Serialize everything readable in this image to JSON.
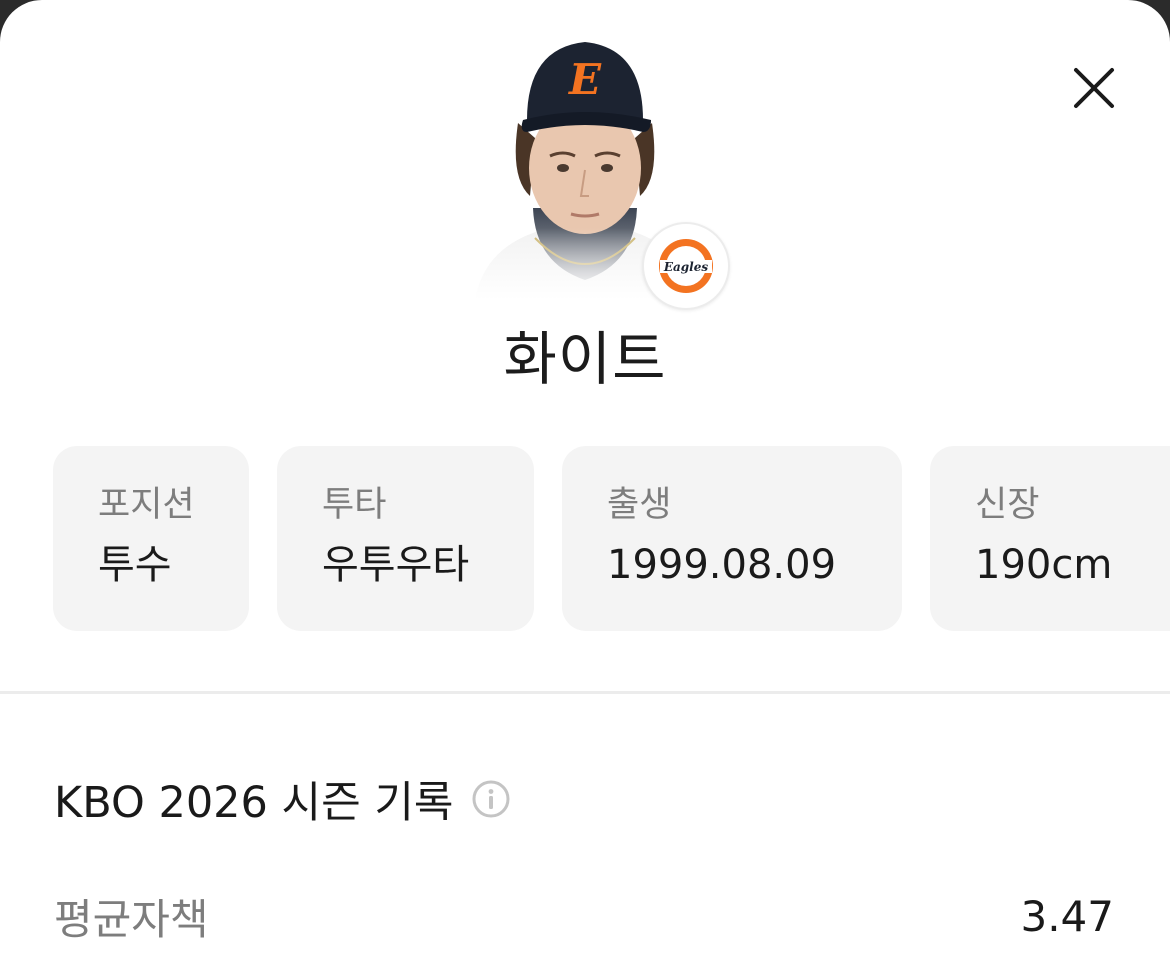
{
  "player": {
    "name": "화이트",
    "team_logo_text": "Eagles",
    "cap_letter": "E"
  },
  "info_cards": [
    {
      "label": "포지션",
      "value": "투수"
    },
    {
      "label": "투타",
      "value": "우투우타"
    },
    {
      "label": "출생",
      "value": "1999.08.09"
    },
    {
      "label": "신장",
      "value": "190cm"
    }
  ],
  "stats_section": {
    "title": "KBO 2026 시즌 기록",
    "info_icon": "info-circle-icon"
  },
  "stats": [
    {
      "label": "평균자책",
      "value": "3.47"
    }
  ],
  "icons": {
    "close": "close-icon"
  },
  "colors": {
    "card_bg": "#f4f4f4",
    "label_gray": "#7d7d7d",
    "team_orange": "#f37321",
    "cap_navy": "#1c2331"
  }
}
